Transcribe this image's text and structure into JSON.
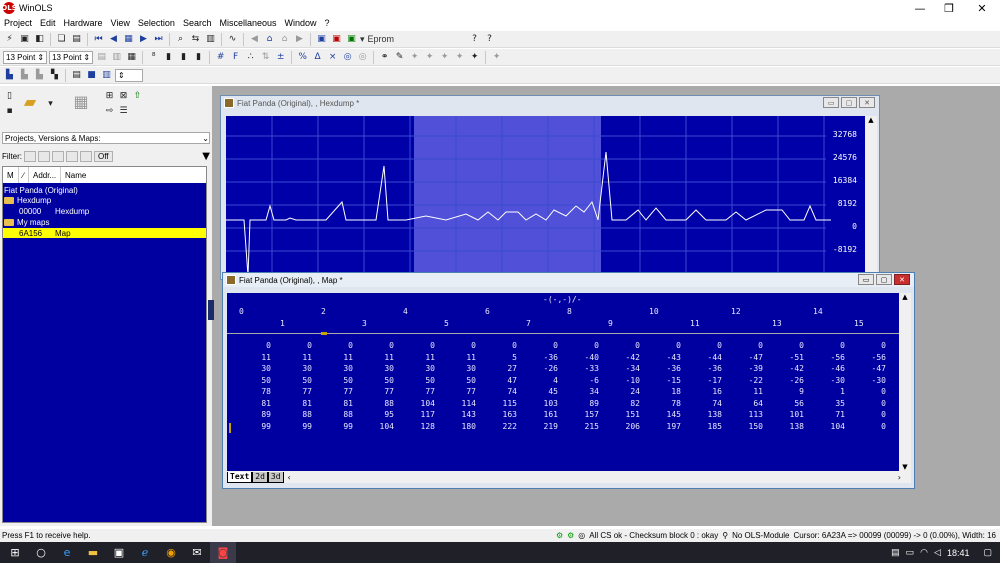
{
  "app": {
    "title": "WinOLS",
    "logo_text": "OLS"
  },
  "menu": [
    "Project",
    "Edit",
    "Hardware",
    "View",
    "Selection",
    "Search",
    "Miscellaneous",
    "Window",
    "?"
  ],
  "toolbar2": {
    "point_size_a": "13 Point",
    "point_size_b": "13 Point",
    "eprom_label": "Eprom"
  },
  "left": {
    "combo_label": "Projects, Versions & Maps:",
    "filter_label": "Filter:",
    "filter_off": "Off",
    "columns": [
      "M",
      "∕",
      "Addr...",
      "Name"
    ],
    "tree": [
      {
        "addr": "Fiat Panda (Original)",
        "name": "",
        "type": "project"
      },
      {
        "addr": "Hexdump",
        "name": "",
        "type": "folder"
      },
      {
        "addr": "00000",
        "name": "Hexdump",
        "type": "item"
      },
      {
        "addr": "My maps",
        "name": "",
        "type": "folder"
      },
      {
        "addr": "6A156",
        "name": "Map",
        "type": "selected"
      }
    ]
  },
  "hexwin": {
    "title": "Fiat Panda (Original), , Hexdump *",
    "yticks": [
      "32768",
      "24576",
      "16384",
      "8192",
      "0",
      "-8192"
    ]
  },
  "mapwin": {
    "title": "Fiat Panda (Original), , Map *",
    "axis_label": "-(-,-)/-",
    "top_cols": [
      "0",
      "2",
      "4",
      "6",
      "8",
      "10",
      "12",
      "14"
    ],
    "bottom_cols": [
      "1",
      "3",
      "5",
      "7",
      "9",
      "11",
      "13",
      "15"
    ],
    "rows": [
      [
        "0",
        "0",
        "0",
        "0",
        "0",
        "0",
        "0",
        "0",
        "0",
        "0",
        "0",
        "0",
        "0",
        "0",
        "0",
        "0"
      ],
      [
        "11",
        "11",
        "11",
        "11",
        "11",
        "11",
        "5",
        "-36",
        "-40",
        "-42",
        "-43",
        "-44",
        "-47",
        "-51",
        "-56",
        "-56"
      ],
      [
        "30",
        "30",
        "30",
        "30",
        "30",
        "30",
        "27",
        "-26",
        "-33",
        "-34",
        "-36",
        "-36",
        "-39",
        "-42",
        "-46",
        "-47"
      ],
      [
        "50",
        "50",
        "50",
        "50",
        "50",
        "50",
        "47",
        "4",
        "-6",
        "-10",
        "-15",
        "-17",
        "-22",
        "-26",
        "-30",
        "-30"
      ],
      [
        "78",
        "77",
        "77",
        "77",
        "77",
        "77",
        "74",
        "45",
        "34",
        "24",
        "18",
        "16",
        "11",
        "9",
        "1",
        "0"
      ],
      [
        "81",
        "81",
        "81",
        "88",
        "104",
        "114",
        "115",
        "103",
        "89",
        "82",
        "78",
        "74",
        "64",
        "56",
        "35",
        "0"
      ],
      [
        "89",
        "88",
        "88",
        "95",
        "117",
        "143",
        "163",
        "161",
        "157",
        "151",
        "145",
        "138",
        "113",
        "101",
        "71",
        "0"
      ],
      [
        "99",
        "99",
        "99",
        "104",
        "128",
        "180",
        "222",
        "219",
        "215",
        "206",
        "197",
        "185",
        "150",
        "138",
        "104",
        "0"
      ]
    ],
    "tabs": [
      "Text",
      "2d",
      "3d"
    ]
  },
  "status": {
    "left": "Press F1 to receive help.",
    "checksum": "All CS ok - Checksum block 0 : okay",
    "module": "No OLS-Module",
    "cursor": "Cursor: 6A23A => 00099 (00099) -> 0 (0.00%), Width: 16"
  },
  "taskbar": {
    "time": "18:41"
  }
}
